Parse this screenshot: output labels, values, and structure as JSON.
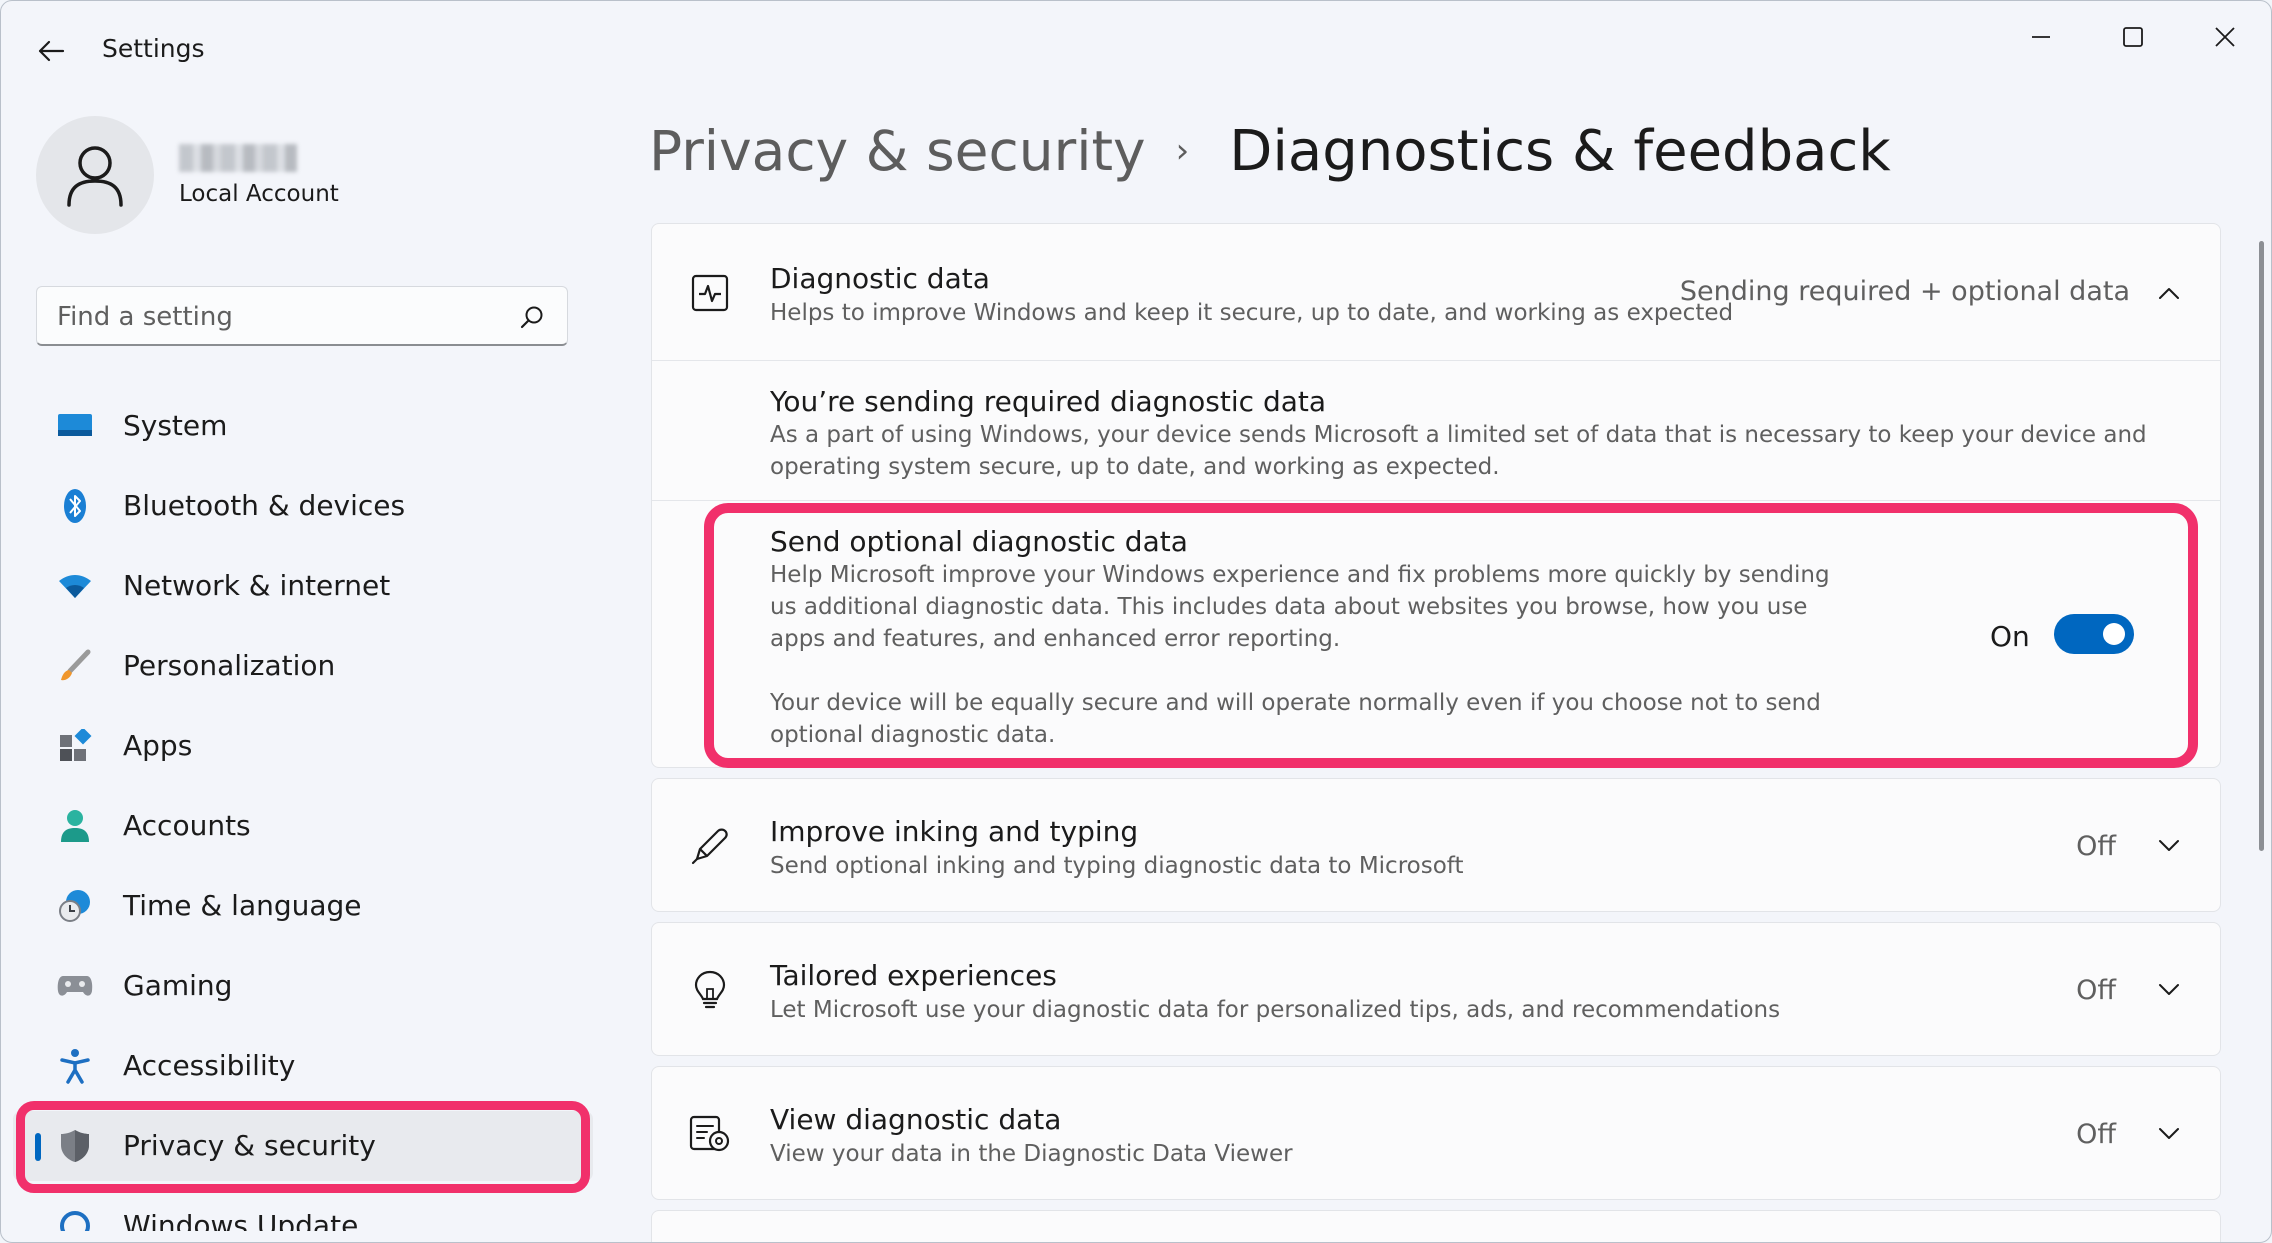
{
  "window": {
    "title": "Settings"
  },
  "profile": {
    "account_type": "Local Account"
  },
  "search": {
    "placeholder": "Find a setting"
  },
  "nav": {
    "items": [
      {
        "label": "System",
        "icon": "system-icon"
      },
      {
        "label": "Bluetooth & devices",
        "icon": "bluetooth-icon"
      },
      {
        "label": "Network & internet",
        "icon": "wifi-icon"
      },
      {
        "label": "Personalization",
        "icon": "brush-icon"
      },
      {
        "label": "Apps",
        "icon": "apps-icon"
      },
      {
        "label": "Accounts",
        "icon": "person-icon"
      },
      {
        "label": "Time & language",
        "icon": "clock-globe-icon"
      },
      {
        "label": "Gaming",
        "icon": "gamepad-icon"
      },
      {
        "label": "Accessibility",
        "icon": "accessibility-icon"
      },
      {
        "label": "Privacy & security",
        "icon": "shield-icon",
        "active": true
      },
      {
        "label": "Windows Update",
        "icon": "update-icon"
      }
    ]
  },
  "breadcrumb": {
    "parent": "Privacy & security",
    "separator": "›",
    "current": "Diagnostics & feedback"
  },
  "diagnostic_data": {
    "title": "Diagnostic data",
    "description": "Helps to improve Windows and keep it secure, up to date, and working as expected",
    "status": "Sending required + optional data",
    "required": {
      "title": "You’re sending required diagnostic data",
      "line1": "As a part of using Windows, your device sends Microsoft a limited set of data that is necessary to keep your device and",
      "line2": "operating system secure, up to date, and working as expected."
    },
    "optional": {
      "title": "Send optional diagnostic data",
      "line1": "Help Microsoft improve your Windows experience and fix problems more quickly by sending",
      "line2": "us additional diagnostic data. This includes data about websites you browse, how you use",
      "line3": "apps and features, and enhanced error reporting.",
      "line4": "Your device will be equally secure and will operate normally even if you choose not to send",
      "line5": "optional diagnostic data.",
      "toggle_label": "On",
      "toggle_on": true
    }
  },
  "inking": {
    "title": "Improve inking and typing",
    "description": "Send optional inking and typing diagnostic data to Microsoft",
    "status": "Off"
  },
  "tailored": {
    "title": "Tailored experiences",
    "description": "Let Microsoft use your diagnostic data for personalized tips, ads, and recommendations",
    "status": "Off"
  },
  "view_data": {
    "title": "View diagnostic data",
    "description": "View your data in the Diagnostic Data Viewer",
    "status": "Off"
  },
  "colors": {
    "accent": "#0067c0",
    "highlight": "#f1306b"
  }
}
